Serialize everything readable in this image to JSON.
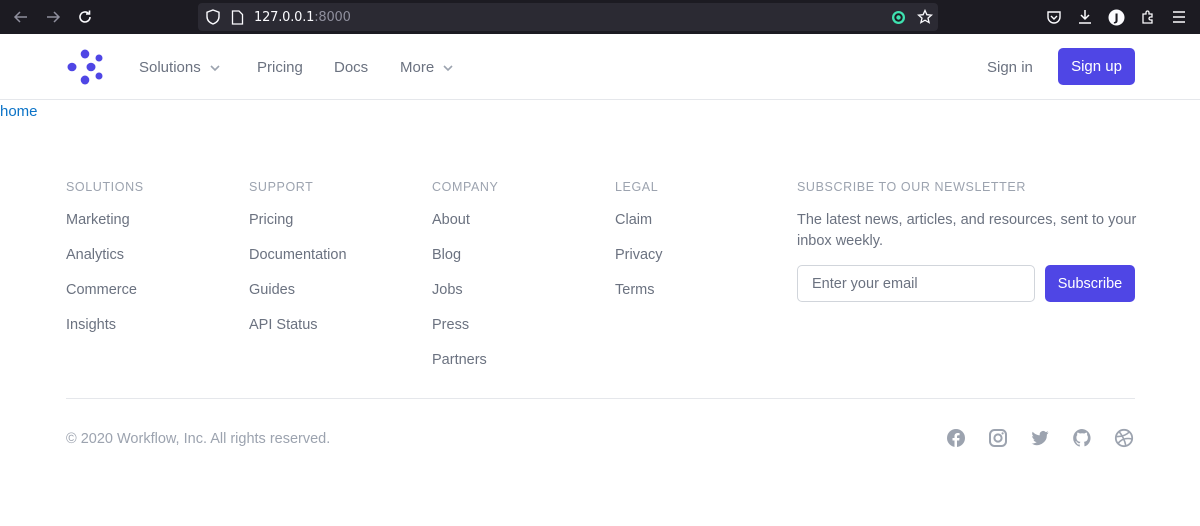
{
  "browser": {
    "url_host": "127.0.0.1",
    "url_port": ":8000",
    "icons": [
      "back-arrow-icon",
      "forward-arrow-icon",
      "reload-icon",
      "shield-icon",
      "page-icon",
      "extension-status-icon",
      "star-icon",
      "pocket-icon",
      "download-icon",
      "profile-icon",
      "extensions-icon",
      "menu-icon"
    ],
    "profile_initial": "J"
  },
  "header": {
    "nav": [
      {
        "label": "Solutions",
        "has_dropdown": true
      },
      {
        "label": "Pricing",
        "has_dropdown": false
      },
      {
        "label": "Docs",
        "has_dropdown": false
      },
      {
        "label": "More",
        "has_dropdown": true
      }
    ],
    "signin_label": "Sign in",
    "signup_label": "Sign up"
  },
  "home_link": "home",
  "footer": {
    "columns": [
      {
        "title": "Solutions",
        "links": [
          "Marketing",
          "Analytics",
          "Commerce",
          "Insights"
        ]
      },
      {
        "title": "Support",
        "links": [
          "Pricing",
          "Documentation",
          "Guides",
          "API Status"
        ]
      },
      {
        "title": "Company",
        "links": [
          "About",
          "Blog",
          "Jobs",
          "Press",
          "Partners"
        ]
      },
      {
        "title": "Legal",
        "links": [
          "Claim",
          "Privacy",
          "Terms"
        ]
      }
    ],
    "newsletter": {
      "title": "Subscribe to our newsletter",
      "text": "The latest news, articles, and resources, sent to your inbox weekly.",
      "placeholder": "Enter your email",
      "button_label": "Subscribe"
    },
    "copyright": "© 2020 Workflow, Inc. All rights reserved.",
    "social": [
      "facebook-icon",
      "instagram-icon",
      "twitter-icon",
      "github-icon",
      "dribbble-icon"
    ]
  },
  "colors": {
    "brand": "#4f46e5",
    "link": "#0b73c7"
  }
}
